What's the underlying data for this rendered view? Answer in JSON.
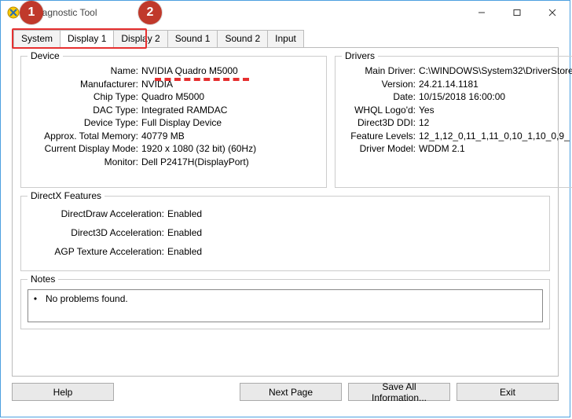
{
  "window": {
    "title": "X Diagnostic Tool"
  },
  "tabs": {
    "items": [
      "System",
      "Display 1",
      "Display 2",
      "Sound 1",
      "Sound 2",
      "Input"
    ],
    "active_index": 1
  },
  "annotations": {
    "badge1": "1",
    "badge2": "2"
  },
  "device": {
    "legend": "Device",
    "rows": [
      {
        "k": "Name:",
        "v": "NVIDIA Quadro M5000"
      },
      {
        "k": "Manufacturer:",
        "v": "NVIDIA"
      },
      {
        "k": "Chip Type:",
        "v": "Quadro M5000"
      },
      {
        "k": "DAC Type:",
        "v": "Integrated RAMDAC"
      },
      {
        "k": "Device Type:",
        "v": "Full Display Device"
      },
      {
        "k": "Approx. Total Memory:",
        "v": "40779 MB"
      },
      {
        "k": "Current Display Mode:",
        "v": "1920 x 1080 (32 bit) (60Hz)"
      },
      {
        "k": "Monitor:",
        "v": "Dell P2417H(DisplayPort)"
      }
    ]
  },
  "drivers": {
    "legend": "Drivers",
    "rows": [
      {
        "k": "Main Driver:",
        "v": "C:\\WINDOWS\\System32\\DriverStore"
      },
      {
        "k": "Version:",
        "v": "24.21.14.1181"
      },
      {
        "k": "Date:",
        "v": "10/15/2018 16:00:00"
      },
      {
        "k": "WHQL Logo'd:",
        "v": "Yes"
      },
      {
        "k": "Direct3D DDI:",
        "v": "12"
      },
      {
        "k": "Feature Levels:",
        "v": "12_1,12_0,11_1,11_0,10_1,10_0,9_"
      },
      {
        "k": "Driver Model:",
        "v": "WDDM 2.1"
      }
    ]
  },
  "dx": {
    "legend": "DirectX Features",
    "rows": [
      {
        "k": "DirectDraw Acceleration:",
        "v": "Enabled"
      },
      {
        "k": "Direct3D Acceleration:",
        "v": "Enabled"
      },
      {
        "k": "AGP Texture Acceleration:",
        "v": "Enabled"
      }
    ]
  },
  "notes": {
    "legend": "Notes",
    "text": "No problems found."
  },
  "buttons": {
    "help": "Help",
    "next": "Next Page",
    "save": "Save All Information...",
    "exit": "Exit"
  }
}
